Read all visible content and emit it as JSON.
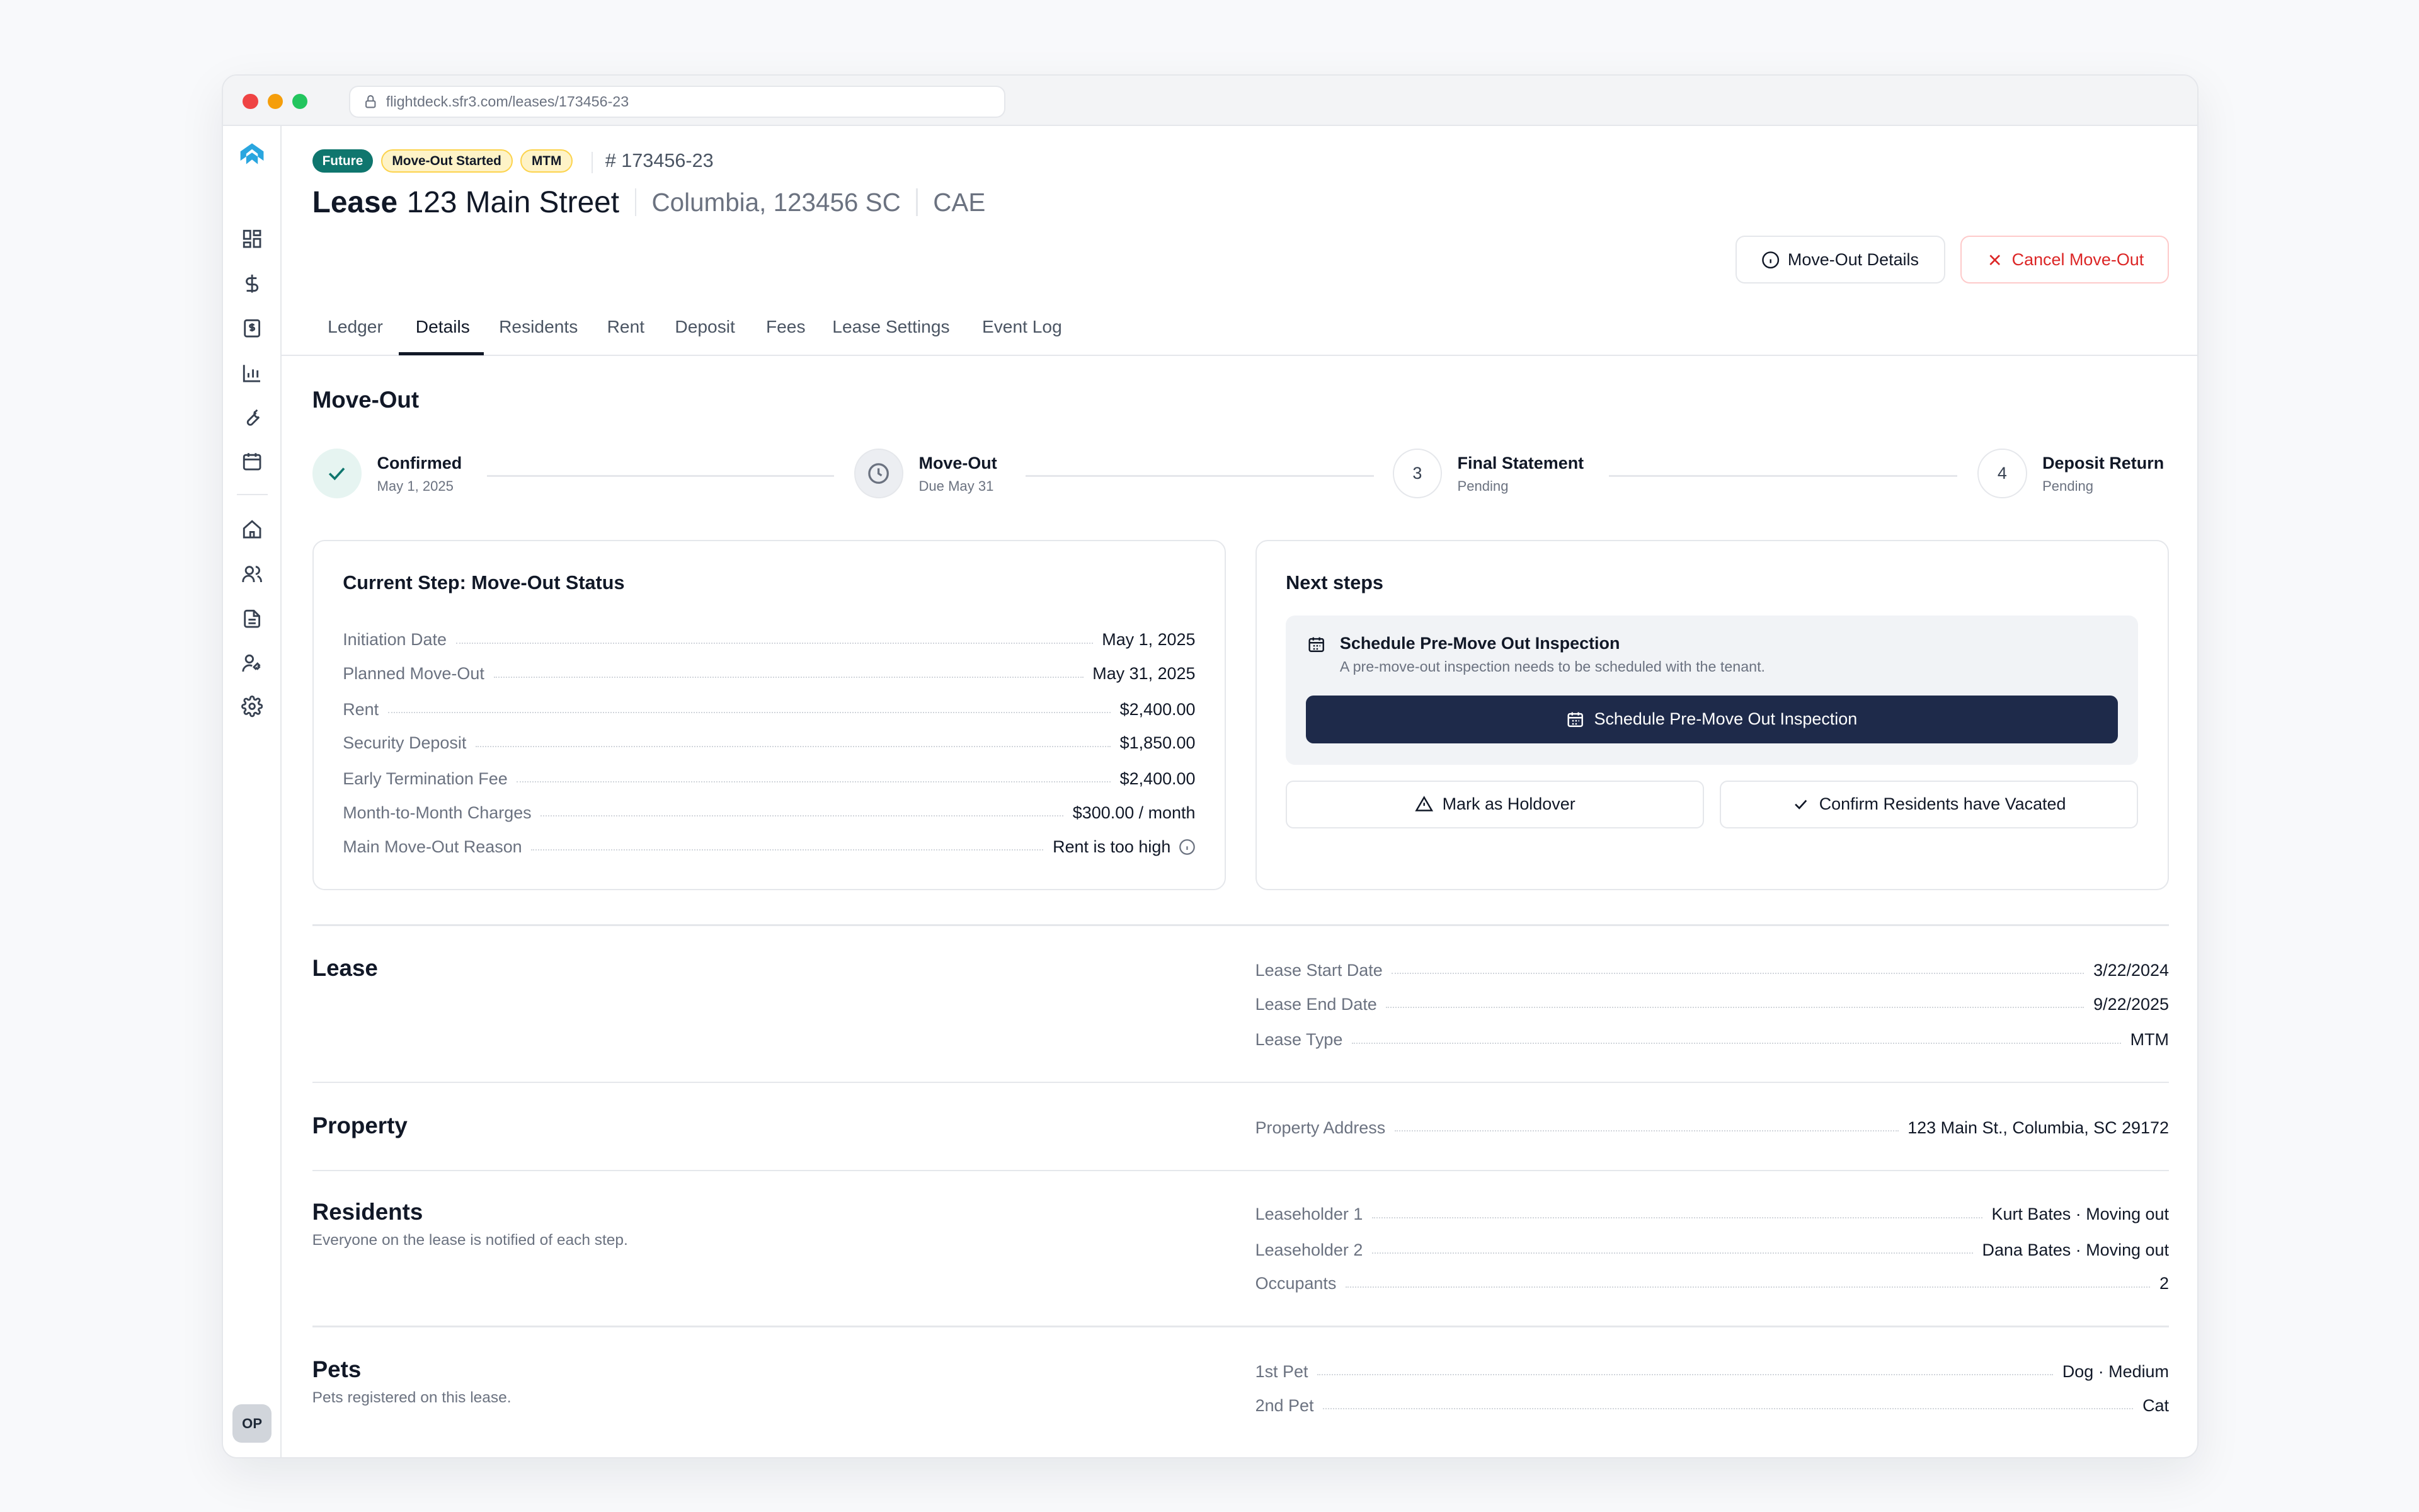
{
  "browser": {
    "url": "flightdeck.sfr3.com/leases/173456-23"
  },
  "sidebar": {
    "icons": [
      "logo-icon",
      "dashboard-icon",
      "dollar-icon",
      "receipt-icon",
      "bar-chart-icon",
      "wrench-icon",
      "calendar-icon",
      "home-icon",
      "users-icon",
      "document-icon",
      "user-key-icon",
      "gear-icon"
    ],
    "avatar": "OP"
  },
  "header": {
    "badges": [
      "Future",
      "Move-Out Started",
      "MTM"
    ],
    "lease_number": "# 173456-23",
    "title_prefix": "Lease",
    "title_address": "123 Main Street",
    "title_city": "Columbia, 123456 SC",
    "title_market": "CAE",
    "buttons": {
      "details": "Move-Out Details",
      "cancel": "Cancel Move-Out"
    }
  },
  "tabs": [
    "Ledger",
    "Details",
    "Residents",
    "Rent",
    "Deposit",
    "Fees",
    "Lease Settings",
    "Event Log"
  ],
  "active_tab": "Details",
  "moveout": {
    "title": "Move-Out",
    "steps": [
      {
        "name": "Confirmed",
        "meta": "May 1, 2025",
        "state": "done"
      },
      {
        "name": "Move-Out",
        "meta": "Due May 31",
        "state": "current"
      },
      {
        "name": "Final Statement",
        "meta": "Pending",
        "number": "3",
        "state": "todo"
      },
      {
        "name": "Deposit Return",
        "meta": "Pending",
        "number": "4",
        "state": "todo"
      }
    ]
  },
  "status_card": {
    "title": "Current Step: Move-Out Status",
    "rows": [
      {
        "label": "Initiation Date",
        "value": "May 1, 2025"
      },
      {
        "label": "Planned Move-Out",
        "value": "May 31, 2025"
      },
      {
        "label": "Rent",
        "value": "$2,400.00"
      },
      {
        "label": "Security Deposit",
        "value": "$1,850.00"
      },
      {
        "label": "Early Termination Fee",
        "value": "$2,400.00"
      },
      {
        "label": "Month-to-Month Charges",
        "value": "$300.00 / month"
      },
      {
        "label": "Main Move-Out Reason",
        "value": "Rent is too high"
      }
    ]
  },
  "next_steps": {
    "title": "Next steps",
    "task_title": "Schedule Pre-Move Out Inspection",
    "task_desc": "A pre-move-out inspection needs to be scheduled with the tenant.",
    "primary": "Schedule Pre-Move Out Inspection",
    "holdover": "Mark as Holdover",
    "vacated": "Confirm Residents have Vacated"
  },
  "lease": {
    "title": "Lease",
    "rows": [
      {
        "label": "Lease Start Date",
        "value": "3/22/2024"
      },
      {
        "label": "Lease End Date",
        "value": "9/22/2025"
      },
      {
        "label": "Lease Type",
        "value": "MTM"
      }
    ]
  },
  "property": {
    "title": "Property",
    "rows": [
      {
        "label": "Property Address",
        "value": "123 Main St., Columbia, SC 29172"
      }
    ]
  },
  "residents": {
    "title": "Residents",
    "subtitle": "Everyone on the lease is notified of each step.",
    "rows": [
      {
        "label": "Leaseholder 1",
        "value": "Kurt Bates · Moving out"
      },
      {
        "label": "Leaseholder 2",
        "value": "Dana Bates · Moving out"
      },
      {
        "label": "Occupants",
        "value": "2"
      }
    ]
  },
  "pets": {
    "title": "Pets",
    "subtitle": "Pets registered on this lease.",
    "rows": [
      {
        "label": "1st Pet",
        "value": "Dog · Medium"
      },
      {
        "label": "2nd Pet",
        "value": "Cat"
      }
    ]
  },
  "colors": {
    "accent": "#1e2a4a",
    "success": "#0f766e",
    "danger": "#dc2626",
    "badge_amber": "#fef3c7"
  }
}
